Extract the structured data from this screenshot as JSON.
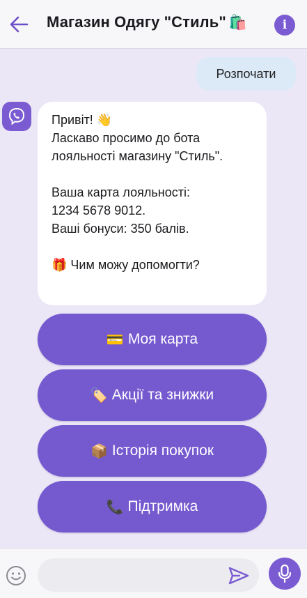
{
  "header": {
    "title": "Магазин Одягу \"Стиль\"",
    "title_emoji": "🛍️",
    "back_icon": "back-arrow-icon",
    "info_icon": "info-icon",
    "info_glyph": "i"
  },
  "messages": {
    "user": "Розпочати",
    "bot": {
      "line1": "Привіт! 👋",
      "line2": "Ласкаво просимо до бота",
      "line3": "лояльності магазину \"Стиль\".",
      "line4": "Ваша карта лояльності:",
      "line5": "1234 5678 9012.",
      "line6": "Ваші бонуси: 350 балів.",
      "line7": "🎁 Чим можу допомогти?"
    }
  },
  "keyboard": [
    {
      "icon": "💳",
      "label": "Моя карта"
    },
    {
      "icon": "🏷️",
      "label": "Акції та знижки"
    },
    {
      "icon": "📦",
      "label": "Історія покупок"
    },
    {
      "icon": "📞",
      "label": "Підтримка"
    }
  ],
  "composer": {
    "placeholder": "",
    "emoji_icon": "smile-icon",
    "send_icon": "send-icon",
    "mic_icon": "mic-icon"
  },
  "colors": {
    "accent": "#7459cf",
    "background": "#ebe7f7",
    "user_bubble": "#dce9f7",
    "bot_bubble": "#ffffff"
  }
}
